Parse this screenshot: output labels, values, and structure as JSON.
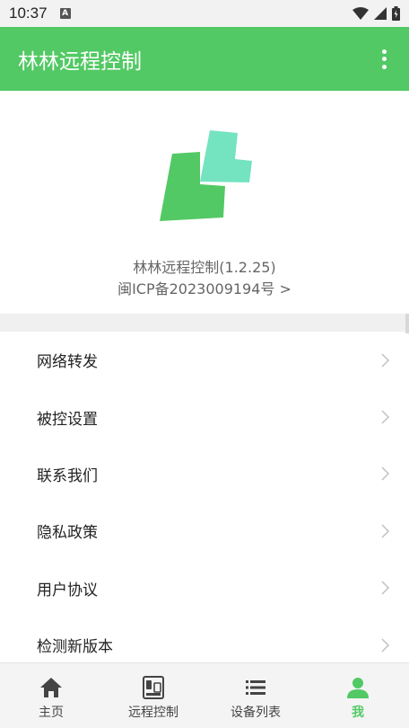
{
  "status_bar": {
    "time": "10:37",
    "notification_letter": "A"
  },
  "app_bar": {
    "title": "林林远程控制",
    "more_icon": "more-vert-icon"
  },
  "about": {
    "app_version": "林林远程控制(1.2.25)",
    "icp_text": "闽ICP备2023009194号 >",
    "logo_colors": {
      "dark": "#52c964",
      "light": "#74e3c0"
    }
  },
  "menu": {
    "items": [
      {
        "label": "网络转发"
      },
      {
        "label": "被控设置"
      },
      {
        "label": "联系我们"
      },
      {
        "label": "隐私政策"
      },
      {
        "label": "用户协议"
      },
      {
        "label": "检测新版本"
      }
    ]
  },
  "bottom_nav": {
    "tabs": [
      {
        "label": "主页",
        "icon": "home-icon"
      },
      {
        "label": "远程控制",
        "icon": "remote-control-icon"
      },
      {
        "label": "设备列表",
        "icon": "list-icon"
      },
      {
        "label": "我",
        "icon": "person-icon",
        "active": true
      }
    ]
  },
  "colors": {
    "accent": "#52c964",
    "nav_inactive": "#444444"
  }
}
